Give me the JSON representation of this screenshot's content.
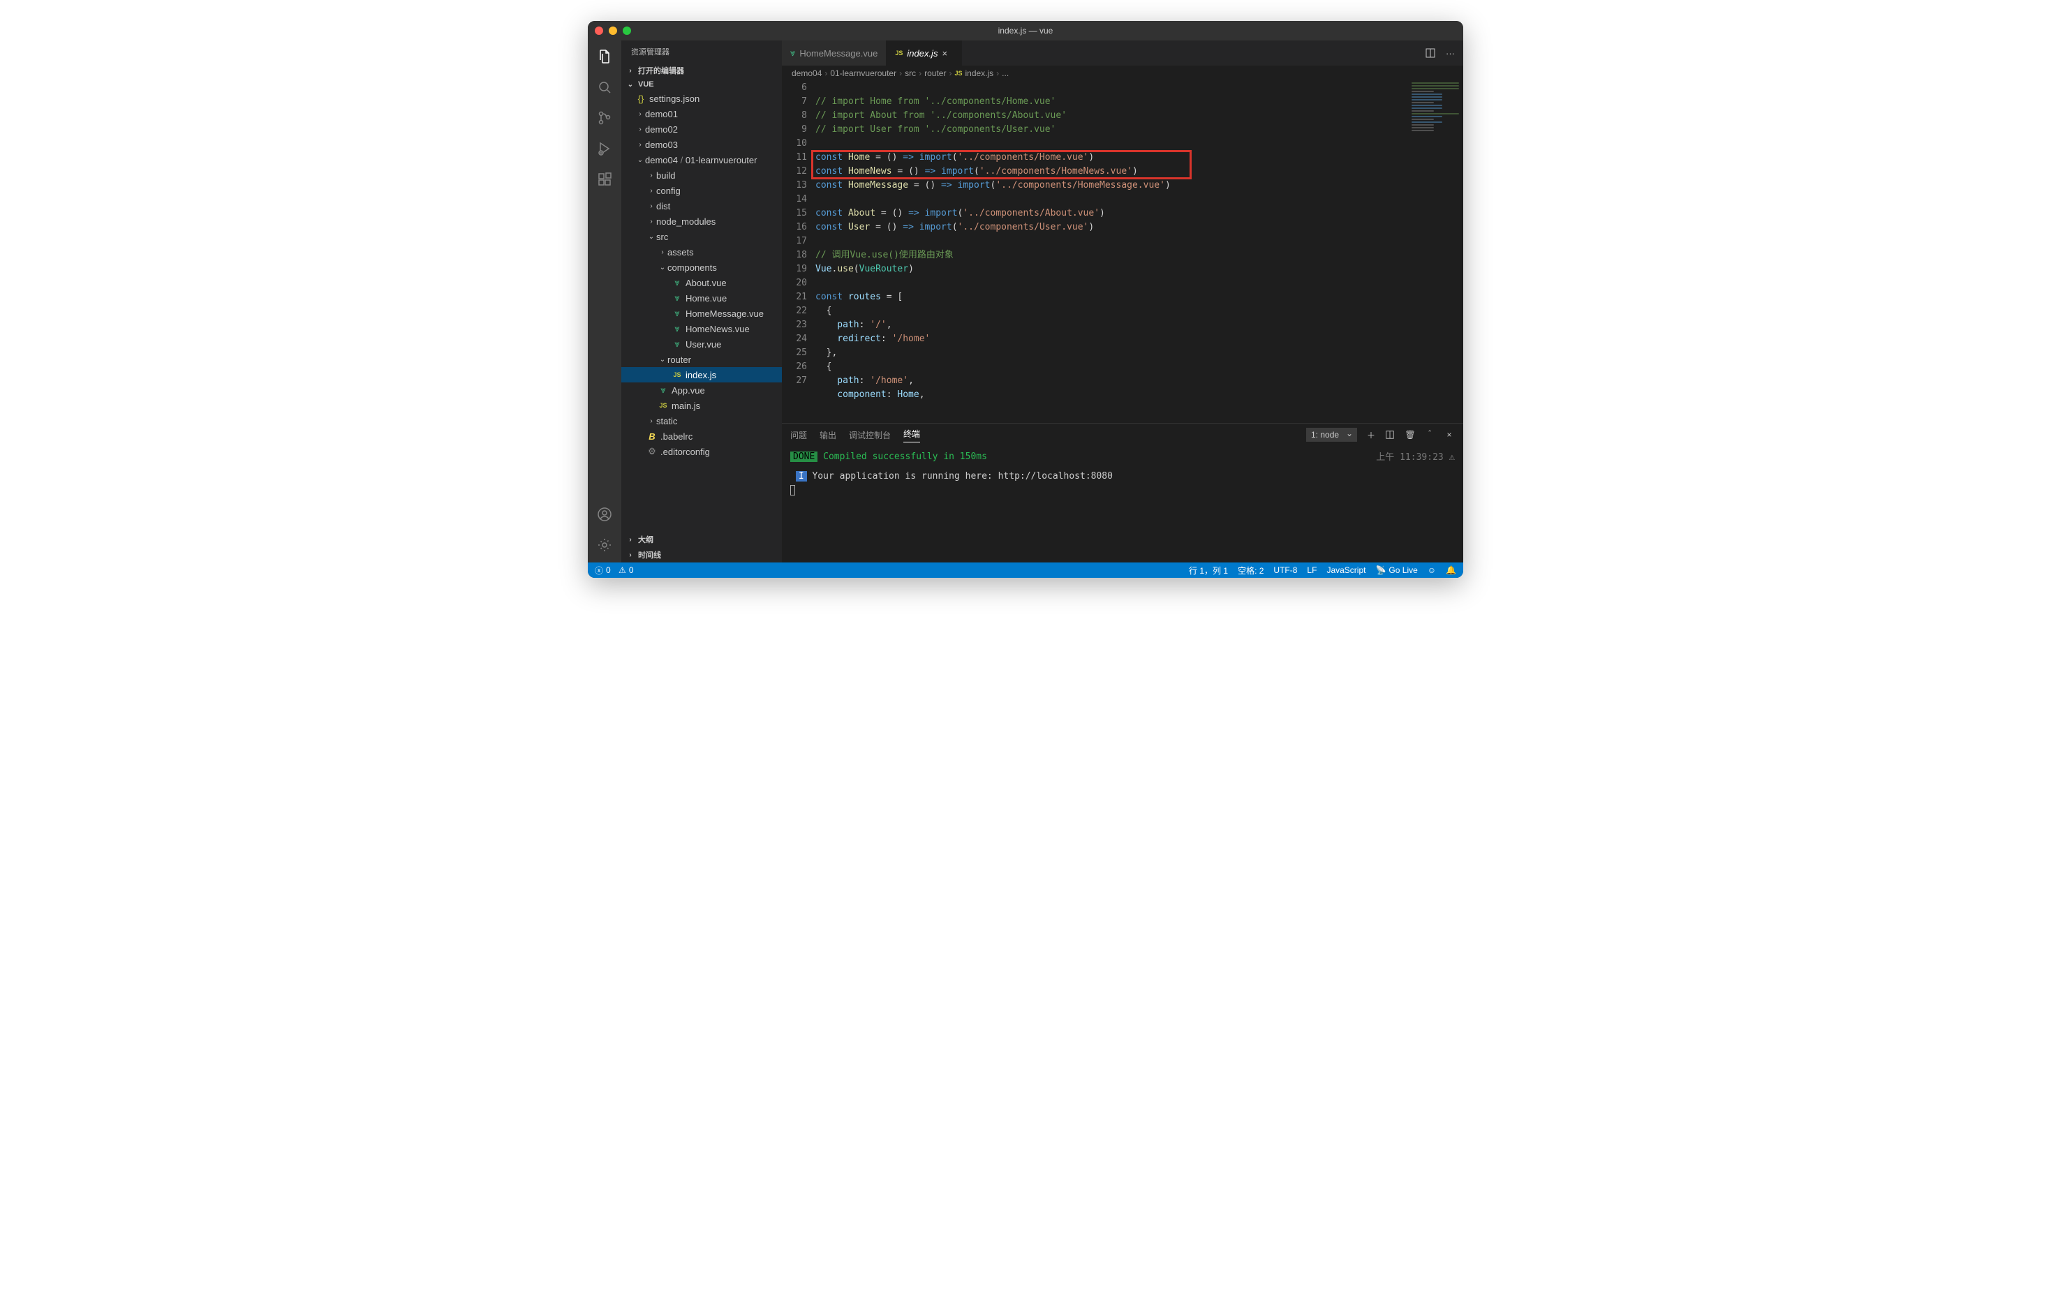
{
  "titlebar": {
    "title": "index.js — vue"
  },
  "sidebar": {
    "title": "资源管理器",
    "sections": {
      "open_editors": "打开的编辑器",
      "outline": "大纲",
      "timeline": "时间线",
      "folder": "VUE"
    },
    "tree": {
      "settings": "settings.json",
      "demo01": "demo01",
      "demo02": "demo02",
      "demo03": "demo03",
      "demo04": "demo04",
      "demo04_sub": "01-learnvuerouter",
      "build": "build",
      "config": "config",
      "dist": "dist",
      "node_modules": "node_modules",
      "src": "src",
      "assets": "assets",
      "components": "components",
      "about_vue": "About.vue",
      "home_vue": "Home.vue",
      "homemessage_vue": "HomeMessage.vue",
      "homenews_vue": "HomeNews.vue",
      "user_vue": "User.vue",
      "router": "router",
      "index_js": "index.js",
      "app_vue": "App.vue",
      "main_js": "main.js",
      "static": "static",
      "babelrc": ".babelrc",
      "editorconfig": ".editorconfig"
    }
  },
  "tabs": {
    "t1": "HomeMessage.vue",
    "t2": "index.js"
  },
  "breadcrumb": {
    "p1": "demo04",
    "p2": "01-learnvuerouter",
    "p3": "src",
    "p4": "router",
    "p5": "index.js",
    "p6": "..."
  },
  "code": {
    "l6": "// import Home from '../components/Home.vue'",
    "l7": "// import About from '../components/About.vue'",
    "l8": "// import User from '../components/User.vue'",
    "l9": "",
    "l10a": "const ",
    "l10b": "Home",
    "l10c": " = () ",
    "l10d": "=>",
    "l10e": " import",
    "l10f": "(",
    "l10g": "'../components/Home.vue'",
    "l10h": ")",
    "l11a": "const ",
    "l11b": "HomeNews",
    "l11c": " = () ",
    "l11d": "=>",
    "l11e": " import",
    "l11f": "(",
    "l11g": "'../components/HomeNews.vue'",
    "l11h": ")",
    "l12a": "const ",
    "l12b": "HomeMessage",
    "l12c": " = () ",
    "l12d": "=>",
    "l12e": " import",
    "l12f": "(",
    "l12g": "'../components/HomeMessage.vue'",
    "l12h": ")",
    "l13": "",
    "l14a": "const ",
    "l14b": "About",
    "l14c": " = () ",
    "l14d": "=>",
    "l14e": " import",
    "l14f": "(",
    "l14g": "'../components/About.vue'",
    "l14h": ")",
    "l15a": "const ",
    "l15b": "User",
    "l15c": " = () ",
    "l15d": "=>",
    "l15e": " import",
    "l15f": "(",
    "l15g": "'../components/User.vue'",
    "l15h": ")",
    "l16": "",
    "l17": "// 调用Vue.use()使用路由对象",
    "l18a": "Vue",
    "l18b": ".",
    "l18c": "use",
    "l18d": "(",
    "l18e": "VueRouter",
    "l18f": ")",
    "l19": "",
    "l20a": "const ",
    "l20b": "routes",
    "l20c": " = [",
    "l21": "  {",
    "l22a": "    path",
    "l22b": ": ",
    "l22c": "'/'",
    "l22d": ",",
    "l23a": "    redirect",
    "l23b": ": ",
    "l23c": "'/home'",
    "l24": "  },",
    "l25": "  {",
    "l26a": "    path",
    "l26b": ": ",
    "l26c": "'/home'",
    "l26d": ",",
    "l27a": "    component",
    "l27b": ": ",
    "l27c": "Home",
    "l27d": ","
  },
  "line_numbers": [
    "6",
    "7",
    "8",
    "9",
    "10",
    "11",
    "12",
    "13",
    "14",
    "15",
    "16",
    "17",
    "18",
    "19",
    "20",
    "21",
    "22",
    "23",
    "24",
    "25",
    "26",
    "27"
  ],
  "panel": {
    "tabs": {
      "problems": "问题",
      "output": "输出",
      "debug": "调试控制台",
      "terminal": "终端"
    },
    "term_select": "1: node",
    "done": "DONE",
    "compiled": " Compiled successfully in 150ms",
    "timestamp": "上午 11:39:23",
    "info_tag": "I",
    "running": " Your application is running here: http://localhost:8080"
  },
  "status": {
    "errors": "0",
    "warnings": "0",
    "ln_col": "行 1，列 1",
    "spaces": "空格: 2",
    "encoding": "UTF-8",
    "eol": "LF",
    "lang": "JavaScript",
    "golive": "Go Live"
  }
}
